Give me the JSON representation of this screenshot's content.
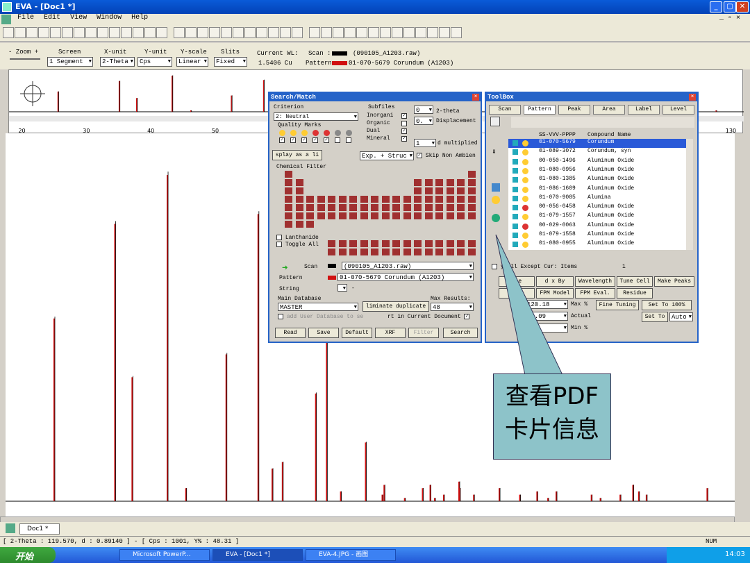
{
  "titlebar": {
    "title": "EVA - [Doc1 *]"
  },
  "menu": [
    "File",
    "Edit",
    "View",
    "Window",
    "Help"
  ],
  "ctrl": {
    "zoom_label": "- Zoom +",
    "screen_label": "Screen",
    "screen_val": "1 Segment",
    "xunit_label": "X-unit",
    "xunit_val": "2-Theta",
    "yunit_label": "Y-unit",
    "yunit_val": "Cps",
    "yscale_label": "Y-scale",
    "yscale_val": "Linear",
    "slits_label": "Slits",
    "slits_val": "Fixed",
    "wl_label": "Current WL:",
    "wl_val": "1.5406 Cu",
    "scan_label": "Scan :",
    "scan_name": "(090105_A1203.raw)",
    "pattern_label": "Pattern",
    "pattern_name": "01-070-5679 Corundum (A1203)"
  },
  "overview_ticks": [
    "20",
    "30",
    "40",
    "50",
    "130"
  ],
  "search": {
    "title": "Search/Match",
    "criterion_label": "Criterion",
    "criterion_val": "2: Neutral",
    "quality_label": "Quality Marks",
    "subfiles_label": "Subfiles",
    "subfiles": [
      {
        "label": "Inorgani",
        "checked": true
      },
      {
        "label": "Organic",
        "checked": false
      },
      {
        "label": "Dual",
        "checked": true
      },
      {
        "label": "Mineral",
        "checked": true
      }
    ],
    "twotheta_val": "0",
    "twotheta_label": "2-theta",
    "disp_val": "0.",
    "disp_label": "Displacement",
    "d_val": "1",
    "d_label": "d multiplied",
    "display_btn": "splay as a li",
    "exp_val": "Exp. + Struc",
    "skip_label": "Skip Non Ambien",
    "chem_label": "Chemical Filter",
    "lanthanide": "Lanthanide",
    "toggle_all": "Toggle All",
    "scan_label": "Scan",
    "scan_val": "(090105_A1203.raw)",
    "pattern_label": "Pattern",
    "pattern_val": "01-070-5679 Corundum (A1203)",
    "string_label": "String",
    "string_val": "-",
    "maindb_label": "Main Database",
    "maindb_val": "MASTER",
    "elim_label": "liminate duplicate",
    "maxres_label": "Max Results:",
    "maxres_val": "48",
    "adduser_label": "add User Database to se",
    "current_label": "rt in Current Document",
    "buttons": [
      "Read",
      "Save",
      "Default",
      "XRF",
      "Filter",
      "Search"
    ]
  },
  "toolbox": {
    "title": "ToolBox",
    "tabs": [
      "Scan",
      "Pattern",
      "Peak",
      "Area",
      "Label",
      "Level"
    ],
    "col1": "SS-VVV-PPPP",
    "col2": "Compound Name",
    "rows": [
      {
        "code": "01-070-5679",
        "name": "Corundum",
        "mark": "I",
        "sel": true
      },
      {
        "code": "01-089-3072",
        "name": "Corundum, syn",
        "mark": "I"
      },
      {
        "code": "00-050-1496",
        "name": "Aluminum Oxide",
        "mark": "I"
      },
      {
        "code": "01-080-0956",
        "name": "Aluminum Oxide",
        "mark": "I"
      },
      {
        "code": "01-080-1385",
        "name": "Aluminum Oxide",
        "mark": "I"
      },
      {
        "code": "01-086-1609",
        "name": "Aluminum Oxide",
        "mark": "I"
      },
      {
        "code": "01-070-9085",
        "name": "Alumina",
        "mark": "C"
      },
      {
        "code": "00-056-0458",
        "name": "Aluminum Oxide",
        "mark": "N"
      },
      {
        "code": "01-079-1557",
        "name": "Aluminum Oxide",
        "mark": "I"
      },
      {
        "code": "00-029-0063",
        "name": "Aluminum Oxide",
        "mark": "N"
      },
      {
        "code": "01-079-1558",
        "name": "Aluminum Oxide",
        "mark": "I"
      },
      {
        "code": "01-080-0955",
        "name": "Aluminum Oxide",
        "mark": "I"
      }
    ],
    "display_all": "y All Except Cur: Items",
    "count": "1",
    "btns1": [
      "ale",
      "d x By",
      "Wavelength",
      "Tune Cell",
      "Make Peaks"
    ],
    "btns2": [
      "en.",
      "FPM Model",
      "FPM Eval.",
      "Residue"
    ],
    "v1": "120.18",
    "l1": "Max %",
    "fine": "Fine Tuning",
    "set100": "Set To 100%",
    "v2": "50.09",
    "l2": "Actual",
    "setto": "Set To",
    "auto": "Auto",
    "v3": ".01",
    "l3": "Min %"
  },
  "callout": {
    "line1": "查看PDF",
    "line2": "卡片信息"
  },
  "doc_tab": "Doc1 *",
  "status": {
    "text": "[ 2-Theta : 119.570, d : 0.89140 ] - [ Cps : 1001, Y% : 48.31 ]",
    "num": "NUM"
  },
  "taskbar": {
    "start": "开始",
    "tasks": [
      "Microsoft PowerP...",
      "EVA - [Doc1 *]",
      "EVA-4.JPG - 画图"
    ],
    "time": "14:03"
  },
  "chart_data": {
    "type": "line",
    "series": [
      {
        "name": "Scan",
        "color": "#000000"
      },
      {
        "name": "Pattern",
        "color": "#d01010"
      }
    ],
    "peaks_x": [
      25.6,
      35.1,
      37.8,
      43.3,
      46.2,
      52.5,
      57.5,
      59.7,
      61.3,
      66.5,
      68.2,
      70.4,
      74.3,
      76.9,
      77.2,
      80.4,
      83.2,
      84.4,
      85.1,
      86.5,
      88.9,
      89.0,
      91.2,
      95.2,
      98.4,
      101.1,
      102.8,
      104.1,
      109.6,
      111.0,
      114.1,
      116.1,
      117.0,
      118.2,
      127.7
    ],
    "peaks_y": [
      56,
      85,
      38,
      100,
      4,
      45,
      88,
      10,
      12,
      33,
      53,
      3,
      18,
      2,
      5,
      1,
      4,
      5,
      1,
      2,
      6,
      4,
      2,
      4,
      2,
      3,
      1,
      3,
      2,
      1,
      2,
      5,
      3,
      2,
      4
    ],
    "xlim": [
      18,
      132
    ]
  }
}
